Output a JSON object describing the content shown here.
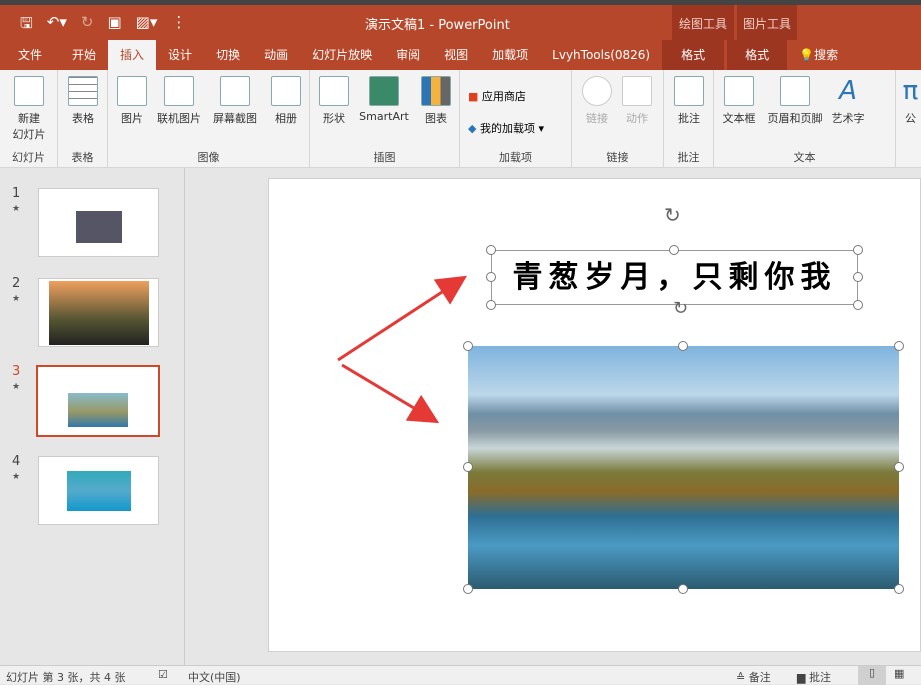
{
  "window": {
    "title": "演示文稿1 - PowerPoint",
    "context_tabs": [
      "绘图工具",
      "图片工具"
    ]
  },
  "tabs": [
    "文件",
    "开始",
    "插入",
    "设计",
    "切换",
    "动画",
    "幻灯片放映",
    "审阅",
    "视图",
    "加载项",
    "LvyhTools(0826)",
    "格式",
    "格式",
    "搜索"
  ],
  "ribbon": {
    "groups": [
      "幻灯片",
      "表格",
      "图像",
      "插图",
      "加载项",
      "链接",
      "批注",
      "文本"
    ],
    "buttons": {
      "new_slide": "新建\n幻灯片",
      "table": "表格",
      "picture": "图片",
      "online_picture": "联机图片",
      "screenshot": "屏幕截图",
      "album": "相册",
      "shapes": "形状",
      "smartart": "SmartArt",
      "chart": "图表",
      "store": "应用商店",
      "my_addins": "我的加载项",
      "link": "链接",
      "action": "动作",
      "comment": "批注",
      "textbox": "文本框",
      "header_footer": "页眉和页脚",
      "wordart": "艺术字",
      "equation": "公"
    }
  },
  "slides": [
    {
      "num": "1"
    },
    {
      "num": "2"
    },
    {
      "num": "3"
    },
    {
      "num": "4"
    }
  ],
  "slide": {
    "title_text": "青葱岁月，只剩你我"
  },
  "status": {
    "slide_info": "幻灯片 第 3 张，共 4 张",
    "language": "中文(中国)",
    "notes": "备注",
    "comments": "批注"
  }
}
